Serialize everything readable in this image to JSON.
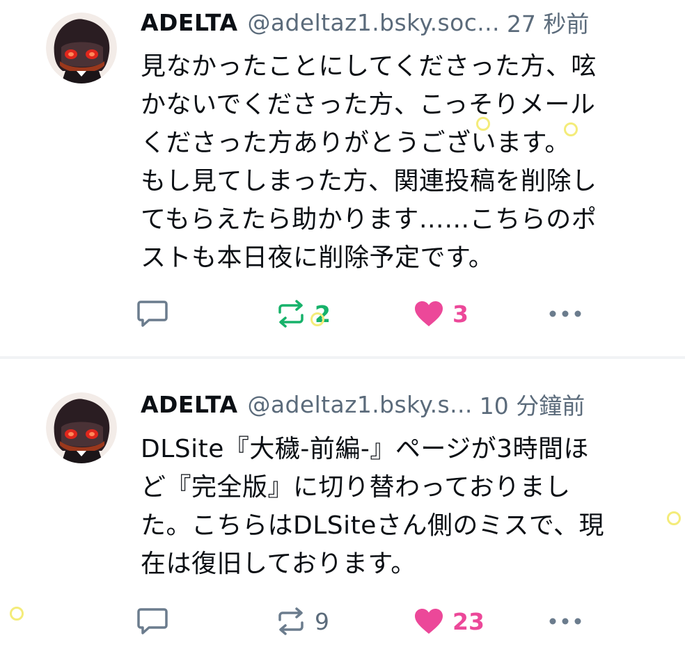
{
  "posts": [
    {
      "display_name": "ADELTA",
      "handle": "@adeltaz1.bsky.soc...",
      "timestamp": "27 秒前",
      "text": "見なかったことにしてくださった方、呟\nかないでくださった方、こっそりメール\nくださった方ありがとうございます。\nもし見てしまった方、関連投稿を削除し\nてもらえたら助かります……こちらのポ\nストも本日夜に削除予定です。",
      "reposts": "2",
      "likes": "3",
      "reposted_by_me": true,
      "liked_by_me": true
    },
    {
      "display_name": "ADELTA",
      "handle": "@adeltaz1.bsky.s...",
      "timestamp": "10 分鐘前",
      "text": "DLSite『大穢-前編-』ページが3時間ほ\nど『完全版』に切り替わっておりまし\nた。こちらはDLSiteさん側のミスで、現\n在は復旧しております。",
      "reposts": "9",
      "likes": "23",
      "reposted_by_me": false,
      "liked_by_me": true
    }
  ],
  "icons": {
    "reply": "speech-bubble-icon",
    "repost": "repost-arrows-icon",
    "like": "heart-icon",
    "more": "ellipsis-icon"
  },
  "colors": {
    "text": "#0b0f14",
    "muted": "#5b6b7b",
    "repost_active": "#17b26a",
    "like": "#ec4899",
    "reply_icon": "#6b7c8d"
  }
}
